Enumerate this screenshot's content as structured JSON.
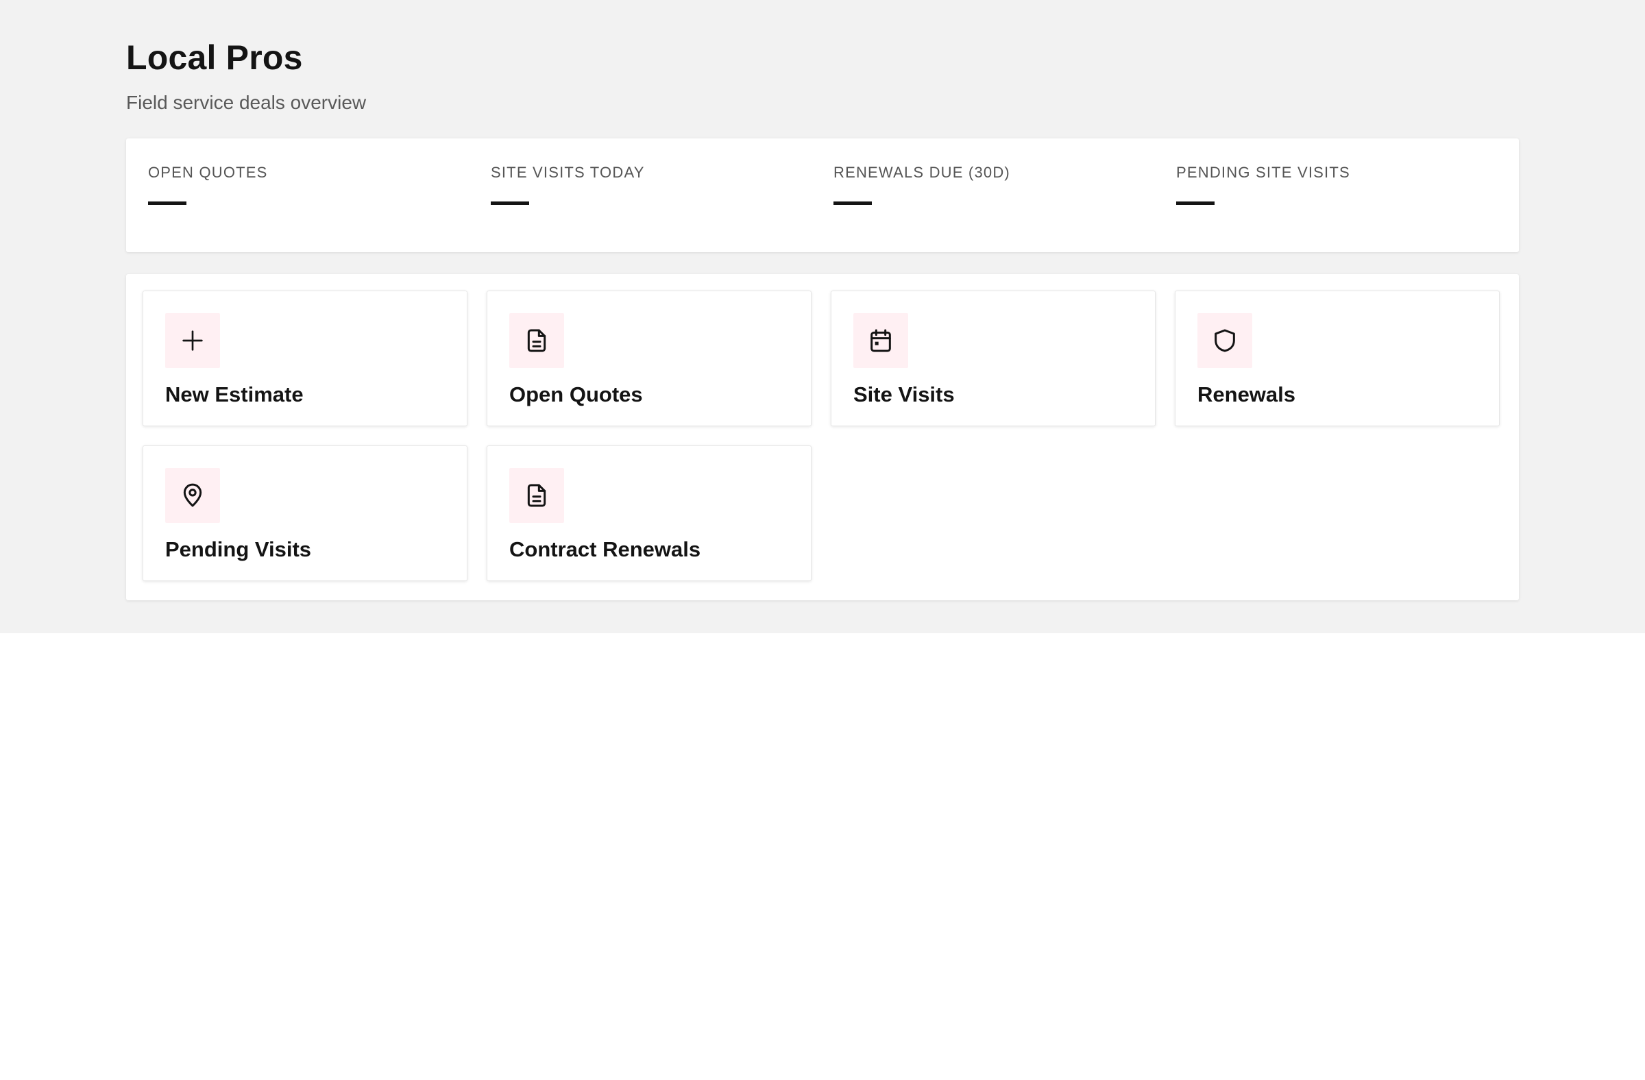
{
  "header": {
    "title": "Local Pros",
    "subtitle": "Field service deals overview"
  },
  "stats": [
    {
      "label": "OPEN QUOTES",
      "value": "—"
    },
    {
      "label": "SITE VISITS TODAY",
      "value": "—"
    },
    {
      "label": "RENEWALS DUE (30D)",
      "value": "—"
    },
    {
      "label": "PENDING SITE VISITS",
      "value": "—"
    }
  ],
  "actions": [
    {
      "label": "New Estimate",
      "icon": "plus-icon"
    },
    {
      "label": "Open Quotes",
      "icon": "document-icon"
    },
    {
      "label": "Site Visits",
      "icon": "calendar-icon"
    },
    {
      "label": "Renewals",
      "icon": "shield-icon"
    },
    {
      "label": "Pending Visits",
      "icon": "map-pin-icon"
    },
    {
      "label": "Contract Renewals",
      "icon": "document-icon"
    }
  ],
  "colors": {
    "page_background": "#f2f2f2",
    "icon_tile_background": "#fff0f3",
    "text": "#141414"
  }
}
